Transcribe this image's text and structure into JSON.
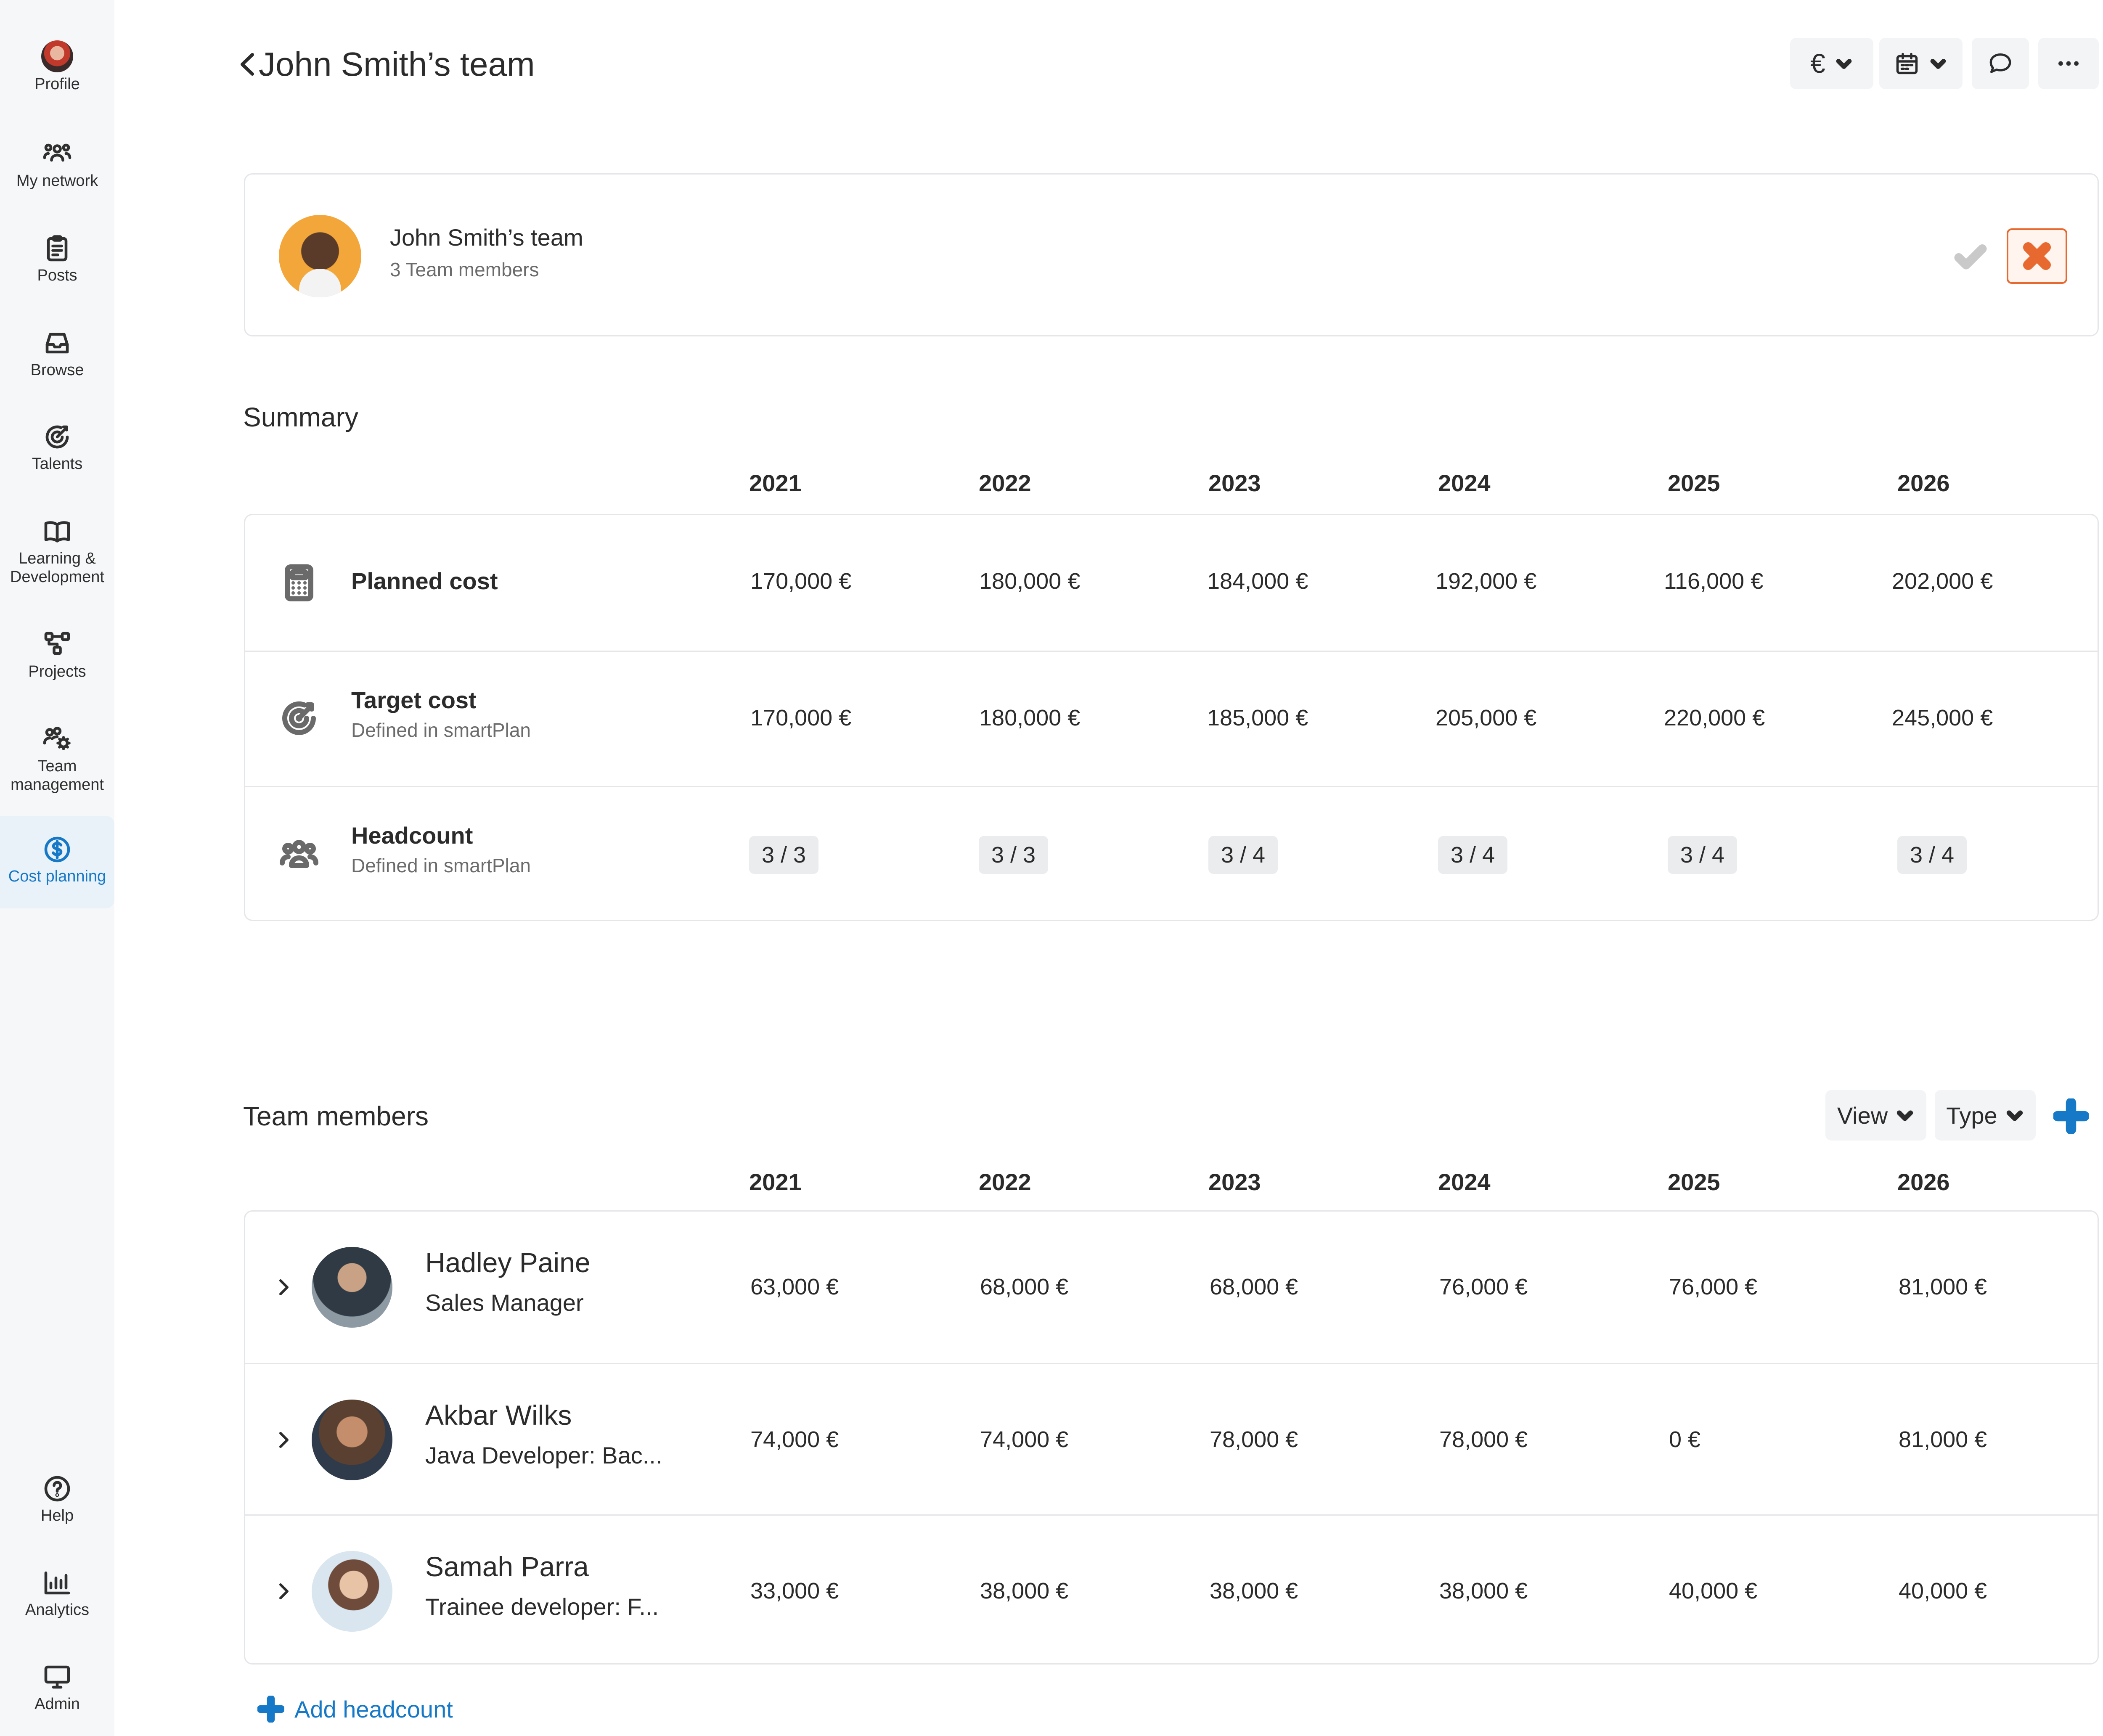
{
  "sidebar": {
    "items": [
      {
        "label": "Profile",
        "icon": "profile-avatar"
      },
      {
        "label": "My network",
        "icon": "network-icon"
      },
      {
        "label": "Posts",
        "icon": "clipboard-icon"
      },
      {
        "label": "Browse",
        "icon": "inbox-icon"
      },
      {
        "label": "Talents",
        "icon": "target-icon"
      },
      {
        "label": "Learning &\nDevelopment",
        "icon": "book-icon"
      },
      {
        "label": "Projects",
        "icon": "projects-icon"
      },
      {
        "label": "Team\nmanagement",
        "icon": "team-gear-icon"
      },
      {
        "label": "Cost planning",
        "icon": "dollar-circle-icon",
        "active": true
      },
      {
        "label": "Help",
        "icon": "help-icon"
      },
      {
        "label": "Analytics",
        "icon": "analytics-icon"
      },
      {
        "label": "Admin",
        "icon": "monitor-icon"
      }
    ]
  },
  "header": {
    "title": "John Smith’s team",
    "currency_symbol": "€"
  },
  "team": {
    "name": "John Smith’s team",
    "members_count": "3 Team members"
  },
  "summary": {
    "title": "Summary",
    "years": [
      "2021",
      "2022",
      "2023",
      "2024",
      "2025",
      "2026"
    ],
    "rows": [
      {
        "title": "Planned cost",
        "sub": "",
        "icon": "calculator-icon",
        "values": [
          "170,000 €",
          "180,000 €",
          "184,000 €",
          "192,000 €",
          "116,000 €",
          "202,000 €"
        ]
      },
      {
        "title": "Target cost",
        "sub": "Defined in smartPlan",
        "icon": "target-icon",
        "values": [
          "170,000 €",
          "180,000 €",
          "185,000 €",
          "205,000 €",
          "220,000 €",
          "245,000 €"
        ]
      },
      {
        "title": "Headcount",
        "sub": "Defined in smartPlan",
        "icon": "people-icon",
        "values": [
          "3 / 3",
          "3 / 3",
          "3 / 4",
          "3 / 4",
          "3 / 4",
          "3 / 4"
        ]
      }
    ]
  },
  "members": {
    "title": "Team members",
    "view_label": "View",
    "type_label": "Type",
    "years": [
      "2021",
      "2022",
      "2023",
      "2024",
      "2025",
      "2026"
    ],
    "rows": [
      {
        "name": "Hadley Paine",
        "role": "Sales Manager",
        "values": [
          "63,000 €",
          "68,000 €",
          "68,000 €",
          "76,000 €",
          "76,000 €",
          "81,000 €"
        ]
      },
      {
        "name": "Akbar Wilks",
        "role": "Java Developer: Bac...",
        "values": [
          "74,000 €",
          "74,000 €",
          "78,000 €",
          "78,000 €",
          "0 €",
          "81,000 €"
        ]
      },
      {
        "name": "Samah Parra",
        "role": "Trainee developer: F...",
        "values": [
          "33,000 €",
          "38,000 €",
          "38,000 €",
          "38,000 €",
          "40,000 €",
          "40,000 €"
        ]
      }
    ],
    "add_label": "Add headcount"
  },
  "colors": {
    "accent": "#1679c7",
    "danger": "#e8692f",
    "sidebar_bg": "#f6f7f9"
  }
}
